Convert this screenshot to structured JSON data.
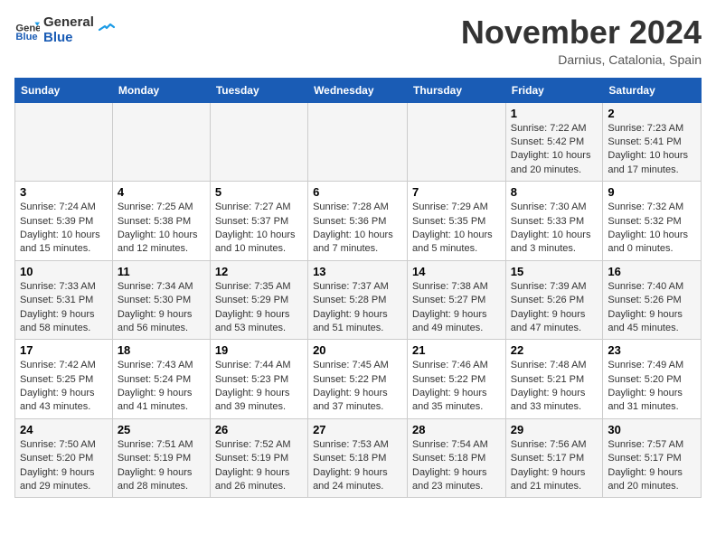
{
  "logo": {
    "line1": "General",
    "line2": "Blue"
  },
  "title": "November 2024",
  "location": "Darnius, Catalonia, Spain",
  "days_of_week": [
    "Sunday",
    "Monday",
    "Tuesday",
    "Wednesday",
    "Thursday",
    "Friday",
    "Saturday"
  ],
  "weeks": [
    [
      {
        "num": "",
        "info": ""
      },
      {
        "num": "",
        "info": ""
      },
      {
        "num": "",
        "info": ""
      },
      {
        "num": "",
        "info": ""
      },
      {
        "num": "",
        "info": ""
      },
      {
        "num": "1",
        "info": "Sunrise: 7:22 AM\nSunset: 5:42 PM\nDaylight: 10 hours and 20 minutes."
      },
      {
        "num": "2",
        "info": "Sunrise: 7:23 AM\nSunset: 5:41 PM\nDaylight: 10 hours and 17 minutes."
      }
    ],
    [
      {
        "num": "3",
        "info": "Sunrise: 7:24 AM\nSunset: 5:39 PM\nDaylight: 10 hours and 15 minutes."
      },
      {
        "num": "4",
        "info": "Sunrise: 7:25 AM\nSunset: 5:38 PM\nDaylight: 10 hours and 12 minutes."
      },
      {
        "num": "5",
        "info": "Sunrise: 7:27 AM\nSunset: 5:37 PM\nDaylight: 10 hours and 10 minutes."
      },
      {
        "num": "6",
        "info": "Sunrise: 7:28 AM\nSunset: 5:36 PM\nDaylight: 10 hours and 7 minutes."
      },
      {
        "num": "7",
        "info": "Sunrise: 7:29 AM\nSunset: 5:35 PM\nDaylight: 10 hours and 5 minutes."
      },
      {
        "num": "8",
        "info": "Sunrise: 7:30 AM\nSunset: 5:33 PM\nDaylight: 10 hours and 3 minutes."
      },
      {
        "num": "9",
        "info": "Sunrise: 7:32 AM\nSunset: 5:32 PM\nDaylight: 10 hours and 0 minutes."
      }
    ],
    [
      {
        "num": "10",
        "info": "Sunrise: 7:33 AM\nSunset: 5:31 PM\nDaylight: 9 hours and 58 minutes."
      },
      {
        "num": "11",
        "info": "Sunrise: 7:34 AM\nSunset: 5:30 PM\nDaylight: 9 hours and 56 minutes."
      },
      {
        "num": "12",
        "info": "Sunrise: 7:35 AM\nSunset: 5:29 PM\nDaylight: 9 hours and 53 minutes."
      },
      {
        "num": "13",
        "info": "Sunrise: 7:37 AM\nSunset: 5:28 PM\nDaylight: 9 hours and 51 minutes."
      },
      {
        "num": "14",
        "info": "Sunrise: 7:38 AM\nSunset: 5:27 PM\nDaylight: 9 hours and 49 minutes."
      },
      {
        "num": "15",
        "info": "Sunrise: 7:39 AM\nSunset: 5:26 PM\nDaylight: 9 hours and 47 minutes."
      },
      {
        "num": "16",
        "info": "Sunrise: 7:40 AM\nSunset: 5:26 PM\nDaylight: 9 hours and 45 minutes."
      }
    ],
    [
      {
        "num": "17",
        "info": "Sunrise: 7:42 AM\nSunset: 5:25 PM\nDaylight: 9 hours and 43 minutes."
      },
      {
        "num": "18",
        "info": "Sunrise: 7:43 AM\nSunset: 5:24 PM\nDaylight: 9 hours and 41 minutes."
      },
      {
        "num": "19",
        "info": "Sunrise: 7:44 AM\nSunset: 5:23 PM\nDaylight: 9 hours and 39 minutes."
      },
      {
        "num": "20",
        "info": "Sunrise: 7:45 AM\nSunset: 5:22 PM\nDaylight: 9 hours and 37 minutes."
      },
      {
        "num": "21",
        "info": "Sunrise: 7:46 AM\nSunset: 5:22 PM\nDaylight: 9 hours and 35 minutes."
      },
      {
        "num": "22",
        "info": "Sunrise: 7:48 AM\nSunset: 5:21 PM\nDaylight: 9 hours and 33 minutes."
      },
      {
        "num": "23",
        "info": "Sunrise: 7:49 AM\nSunset: 5:20 PM\nDaylight: 9 hours and 31 minutes."
      }
    ],
    [
      {
        "num": "24",
        "info": "Sunrise: 7:50 AM\nSunset: 5:20 PM\nDaylight: 9 hours and 29 minutes."
      },
      {
        "num": "25",
        "info": "Sunrise: 7:51 AM\nSunset: 5:19 PM\nDaylight: 9 hours and 28 minutes."
      },
      {
        "num": "26",
        "info": "Sunrise: 7:52 AM\nSunset: 5:19 PM\nDaylight: 9 hours and 26 minutes."
      },
      {
        "num": "27",
        "info": "Sunrise: 7:53 AM\nSunset: 5:18 PM\nDaylight: 9 hours and 24 minutes."
      },
      {
        "num": "28",
        "info": "Sunrise: 7:54 AM\nSunset: 5:18 PM\nDaylight: 9 hours and 23 minutes."
      },
      {
        "num": "29",
        "info": "Sunrise: 7:56 AM\nSunset: 5:17 PM\nDaylight: 9 hours and 21 minutes."
      },
      {
        "num": "30",
        "info": "Sunrise: 7:57 AM\nSunset: 5:17 PM\nDaylight: 9 hours and 20 minutes."
      }
    ]
  ]
}
